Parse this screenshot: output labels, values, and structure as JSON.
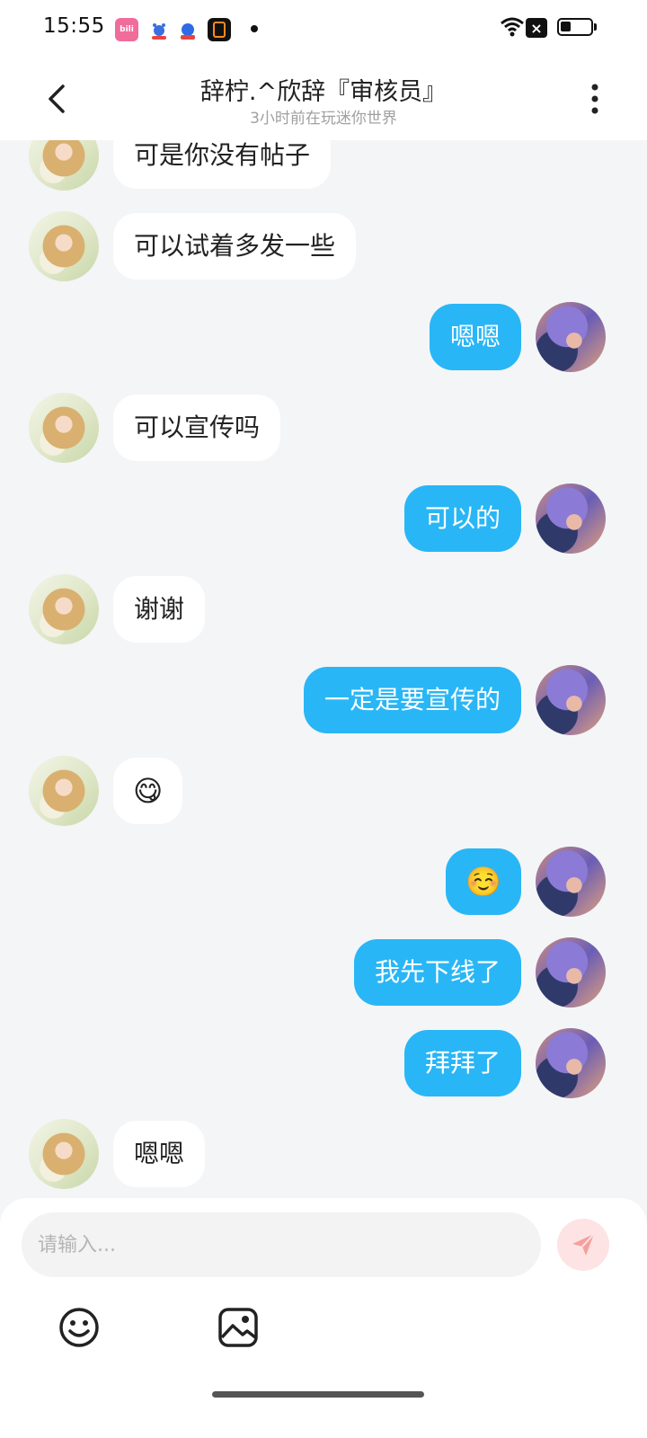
{
  "status_bar": {
    "time": "15:55",
    "notification_apps": [
      "bilibili-icon",
      "baidu-tieba-icon",
      "baidu-icon",
      "orange-app-icon"
    ]
  },
  "header": {
    "title": "辞柠.^欣辞『审核员』",
    "subtitle": "3小时前在玩迷你世界"
  },
  "messages": [
    {
      "side": "left",
      "text": "可是你没有帖子"
    },
    {
      "side": "left",
      "text": "可以试着多发一些"
    },
    {
      "side": "right",
      "text": "嗯嗯"
    },
    {
      "side": "left",
      "text": "可以宣传吗"
    },
    {
      "side": "right",
      "text": "可以的"
    },
    {
      "side": "left",
      "text": "谢谢"
    },
    {
      "side": "right",
      "text": "一定是要宣传的"
    },
    {
      "side": "left",
      "text": "😋"
    },
    {
      "side": "right",
      "text": "☺️"
    },
    {
      "side": "right",
      "text": "我先下线了"
    },
    {
      "side": "right",
      "text": "拜拜了"
    },
    {
      "side": "left",
      "text": "嗯嗯"
    }
  ],
  "input": {
    "placeholder": "请输入...",
    "value": ""
  },
  "colors": {
    "my_bubble": "#29b6f6",
    "their_bubble": "#ffffff",
    "background": "#f4f5f7",
    "send_button_bg": "#fde3e3",
    "send_icon": "#f4a0a0"
  },
  "icons": {
    "back": "back-arrow-icon",
    "more": "more-vertical-icon",
    "send": "send-paper-plane-icon",
    "emoji": "emoji-smile-icon",
    "image": "image-picture-icon"
  }
}
